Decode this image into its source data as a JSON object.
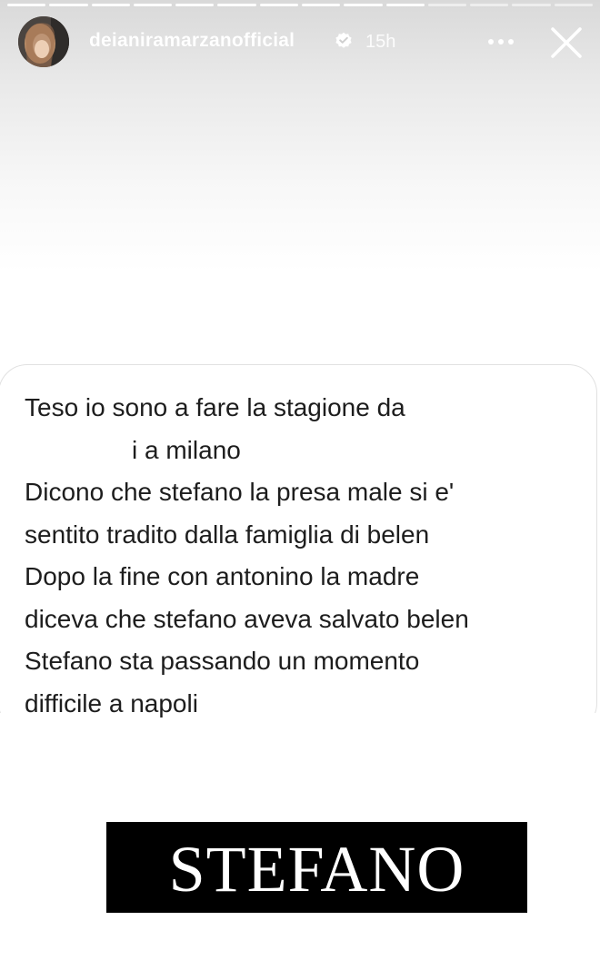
{
  "story": {
    "segments_total": 14,
    "segments_done": 10
  },
  "header": {
    "username": "deianiramarzanofficial",
    "verified": true,
    "time_ago": "15h",
    "more_icon": "more-horizontal-icon",
    "close_icon": "close-icon"
  },
  "message": {
    "lines": [
      "Teso io sono a fare la stagione da",
      "i a milano",
      "Dicono che stefano la presa male si e'",
      "sentito tradito dalla famiglia di belen",
      "Dopo la fine con antonino la madre",
      "diceva che stefano aveva salvato belen",
      "Stefano sta passando un momento",
      "difficile a napoli"
    ]
  },
  "caption": {
    "text": "STEFANO"
  },
  "colors": {
    "caption_bg": "#000000",
    "caption_text": "#ffffff",
    "message_text": "#1d1d1d",
    "header_text": "#ffffff"
  }
}
